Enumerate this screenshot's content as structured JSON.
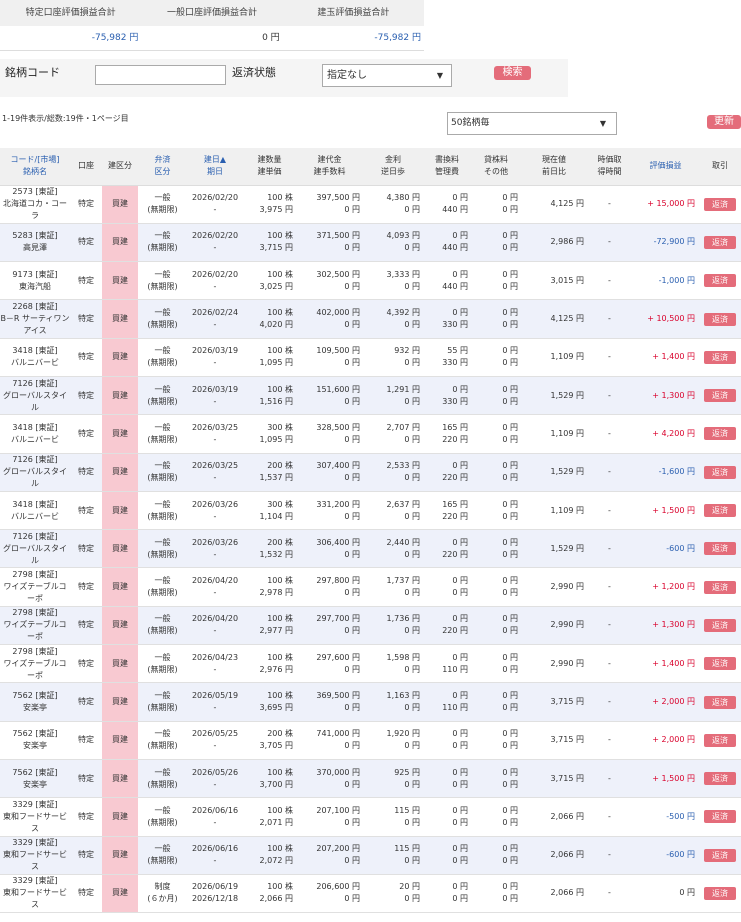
{
  "summary": {
    "headers": [
      "特定口座評価損益合計",
      "一般口座評価損益合計",
      "建玉評価損益合計"
    ],
    "values": [
      "-75,982 円",
      "0 円",
      "-75,982 円"
    ]
  },
  "search": {
    "code_label": "銘柄コード",
    "code_value": "",
    "status_label": "返済状態",
    "status_value": "指定なし",
    "search_button": "検索"
  },
  "list": {
    "count_text": "1-19件表示/総数:19件・1ページ目",
    "per_page": "50銘柄毎",
    "refresh_button": "更新"
  },
  "columns": [
    [
      "コード/[市場]",
      "銘柄名"
    ],
    [
      "口座"
    ],
    [
      "建区分"
    ],
    [
      "弁済",
      "区分"
    ],
    [
      "建日▲",
      "期日"
    ],
    [
      "建数量",
      "建単価"
    ],
    [
      "建代金",
      "建手数料"
    ],
    [
      "金利",
      "逆日歩"
    ],
    [
      "書換料",
      "管理費"
    ],
    [
      "貸株料",
      "その他"
    ],
    [
      "現在値",
      "前日比"
    ],
    [
      "時価取",
      "得時間"
    ],
    [
      "評価損益"
    ],
    [
      "取引"
    ]
  ],
  "rows": [
    {
      "code": "2573 [東証]",
      "name": "北海道コカ・コーラ",
      "account": "特定",
      "side": "買建",
      "rep1": "一般",
      "rep2": "(無期限)",
      "date": "2026/02/20",
      "due": "-",
      "qty": "100 株",
      "price": "3,975 円",
      "amount": "397,500 円",
      "fee": "0 円",
      "interest": "4,380 円",
      "gyaku": "0 円",
      "kakikae": "0 円",
      "kanri": "440 円",
      "kashikabu": "0 円",
      "other": "0 円",
      "current": "4,125 円",
      "diff": "",
      "time": "-",
      "pl": "+ 15,000 円",
      "plc": "red",
      "action": "返済"
    },
    {
      "code": "5283 [東証]",
      "name": "高見澤",
      "account": "特定",
      "side": "買建",
      "rep1": "一般",
      "rep2": "(無期限)",
      "date": "2026/02/20",
      "due": "-",
      "qty": "100 株",
      "price": "3,715 円",
      "amount": "371,500 円",
      "fee": "0 円",
      "interest": "4,093 円",
      "gyaku": "0 円",
      "kakikae": "0 円",
      "kanri": "440 円",
      "kashikabu": "0 円",
      "other": "0 円",
      "current": "2,986 円",
      "diff": "",
      "time": "-",
      "pl": "-72,900 円",
      "plc": "blue",
      "action": "返済"
    },
    {
      "code": "9173 [東証]",
      "name": "東海汽船",
      "account": "特定",
      "side": "買建",
      "rep1": "一般",
      "rep2": "(無期限)",
      "date": "2026/02/20",
      "due": "-",
      "qty": "100 株",
      "price": "3,025 円",
      "amount": "302,500 円",
      "fee": "0 円",
      "interest": "3,333 円",
      "gyaku": "0 円",
      "kakikae": "0 円",
      "kanri": "440 円",
      "kashikabu": "0 円",
      "other": "0 円",
      "current": "3,015 円",
      "diff": "",
      "time": "-",
      "pl": "-1,000 円",
      "plc": "blue",
      "action": "返済"
    },
    {
      "code": "2268 [東証]",
      "name": "B－R サーティワン アイス",
      "account": "特定",
      "side": "買建",
      "rep1": "一般",
      "rep2": "(無期限)",
      "date": "2026/02/24",
      "due": "-",
      "qty": "100 株",
      "price": "4,020 円",
      "amount": "402,000 円",
      "fee": "0 円",
      "interest": "4,392 円",
      "gyaku": "0 円",
      "kakikae": "0 円",
      "kanri": "330 円",
      "kashikabu": "0 円",
      "other": "0 円",
      "current": "4,125 円",
      "diff": "",
      "time": "-",
      "pl": "+ 10,500 円",
      "plc": "red",
      "action": "返済"
    },
    {
      "code": "3418 [東証]",
      "name": "バルニバービ",
      "account": "特定",
      "side": "買建",
      "rep1": "一般",
      "rep2": "(無期限)",
      "date": "2026/03/19",
      "due": "-",
      "qty": "100 株",
      "price": "1,095 円",
      "amount": "109,500 円",
      "fee": "0 円",
      "interest": "932 円",
      "gyaku": "0 円",
      "kakikae": "55 円",
      "kanri": "330 円",
      "kashikabu": "0 円",
      "other": "0 円",
      "current": "1,109 円",
      "diff": "",
      "time": "-",
      "pl": "+ 1,400 円",
      "plc": "red",
      "action": "返済"
    },
    {
      "code": "7126 [東証]",
      "name": "グローバルスタイル",
      "account": "特定",
      "side": "買建",
      "rep1": "一般",
      "rep2": "(無期限)",
      "date": "2026/03/19",
      "due": "-",
      "qty": "100 株",
      "price": "1,516 円",
      "amount": "151,600 円",
      "fee": "0 円",
      "interest": "1,291 円",
      "gyaku": "0 円",
      "kakikae": "0 円",
      "kanri": "330 円",
      "kashikabu": "0 円",
      "other": "0 円",
      "current": "1,529 円",
      "diff": "",
      "time": "-",
      "pl": "+ 1,300 円",
      "plc": "red",
      "action": "返済"
    },
    {
      "code": "3418 [東証]",
      "name": "バルニバービ",
      "account": "特定",
      "side": "買建",
      "rep1": "一般",
      "rep2": "(無期限)",
      "date": "2026/03/25",
      "due": "-",
      "qty": "300 株",
      "price": "1,095 円",
      "amount": "328,500 円",
      "fee": "0 円",
      "interest": "2,707 円",
      "gyaku": "0 円",
      "kakikae": "165 円",
      "kanri": "220 円",
      "kashikabu": "0 円",
      "other": "0 円",
      "current": "1,109 円",
      "diff": "",
      "time": "-",
      "pl": "+ 4,200 円",
      "plc": "red",
      "action": "返済"
    },
    {
      "code": "7126 [東証]",
      "name": "グローバルスタイル",
      "account": "特定",
      "side": "買建",
      "rep1": "一般",
      "rep2": "(無期限)",
      "date": "2026/03/25",
      "due": "-",
      "qty": "200 株",
      "price": "1,537 円",
      "amount": "307,400 円",
      "fee": "0 円",
      "interest": "2,533 円",
      "gyaku": "0 円",
      "kakikae": "0 円",
      "kanri": "220 円",
      "kashikabu": "0 円",
      "other": "0 円",
      "current": "1,529 円",
      "diff": "",
      "time": "-",
      "pl": "-1,600 円",
      "plc": "blue",
      "action": "返済"
    },
    {
      "code": "3418 [東証]",
      "name": "バルニバービ",
      "account": "特定",
      "side": "買建",
      "rep1": "一般",
      "rep2": "(無期限)",
      "date": "2026/03/26",
      "due": "-",
      "qty": "300 株",
      "price": "1,104 円",
      "amount": "331,200 円",
      "fee": "0 円",
      "interest": "2,637 円",
      "gyaku": "0 円",
      "kakikae": "165 円",
      "kanri": "220 円",
      "kashikabu": "0 円",
      "other": "0 円",
      "current": "1,109 円",
      "diff": "",
      "time": "-",
      "pl": "+ 1,500 円",
      "plc": "red",
      "action": "返済"
    },
    {
      "code": "7126 [東証]",
      "name": "グローバルスタイル",
      "account": "特定",
      "side": "買建",
      "rep1": "一般",
      "rep2": "(無期限)",
      "date": "2026/03/26",
      "due": "-",
      "qty": "200 株",
      "price": "1,532 円",
      "amount": "306,400 円",
      "fee": "0 円",
      "interest": "2,440 円",
      "gyaku": "0 円",
      "kakikae": "0 円",
      "kanri": "220 円",
      "kashikabu": "0 円",
      "other": "0 円",
      "current": "1,529 円",
      "diff": "",
      "time": "-",
      "pl": "-600 円",
      "plc": "blue",
      "action": "返済"
    },
    {
      "code": "2798 [東証]",
      "name": "ワイズテーブルコーポ",
      "account": "特定",
      "side": "買建",
      "rep1": "一般",
      "rep2": "(無期限)",
      "date": "2026/04/20",
      "due": "-",
      "qty": "100 株",
      "price": "2,978 円",
      "amount": "297,800 円",
      "fee": "0 円",
      "interest": "1,737 円",
      "gyaku": "0 円",
      "kakikae": "0 円",
      "kanri": "0 円",
      "kashikabu": "0 円",
      "other": "0 円",
      "current": "2,990 円",
      "diff": "",
      "time": "-",
      "pl": "+ 1,200 円",
      "plc": "red",
      "action": "返済"
    },
    {
      "code": "2798 [東証]",
      "name": "ワイズテーブルコーポ",
      "account": "特定",
      "side": "買建",
      "rep1": "一般",
      "rep2": "(無期限)",
      "date": "2026/04/20",
      "due": "-",
      "qty": "100 株",
      "price": "2,977 円",
      "amount": "297,700 円",
      "fee": "0 円",
      "interest": "1,736 円",
      "gyaku": "0 円",
      "kakikae": "0 円",
      "kanri": "220 円",
      "kashikabu": "0 円",
      "other": "0 円",
      "current": "2,990 円",
      "diff": "",
      "time": "-",
      "pl": "+ 1,300 円",
      "plc": "red",
      "action": "返済"
    },
    {
      "code": "2798 [東証]",
      "name": "ワイズテーブルコーポ",
      "account": "特定",
      "side": "買建",
      "rep1": "一般",
      "rep2": "(無期限)",
      "date": "2026/04/23",
      "due": "-",
      "qty": "100 株",
      "price": "2,976 円",
      "amount": "297,600 円",
      "fee": "0 円",
      "interest": "1,598 円",
      "gyaku": "0 円",
      "kakikae": "0 円",
      "kanri": "110 円",
      "kashikabu": "0 円",
      "other": "0 円",
      "current": "2,990 円",
      "diff": "",
      "time": "-",
      "pl": "+ 1,400 円",
      "plc": "red",
      "action": "返済"
    },
    {
      "code": "7562 [東証]",
      "name": "安楽亭",
      "account": "特定",
      "side": "買建",
      "rep1": "一般",
      "rep2": "(無期限)",
      "date": "2026/05/19",
      "due": "-",
      "qty": "100 株",
      "price": "3,695 円",
      "amount": "369,500 円",
      "fee": "0 円",
      "interest": "1,163 円",
      "gyaku": "0 円",
      "kakikae": "0 円",
      "kanri": "110 円",
      "kashikabu": "0 円",
      "other": "0 円",
      "current": "3,715 円",
      "diff": "",
      "time": "-",
      "pl": "+ 2,000 円",
      "plc": "red",
      "action": "返済"
    },
    {
      "code": "7562 [東証]",
      "name": "安楽亭",
      "account": "特定",
      "side": "買建",
      "rep1": "一般",
      "rep2": "(無期限)",
      "date": "2026/05/25",
      "due": "-",
      "qty": "200 株",
      "price": "3,705 円",
      "amount": "741,000 円",
      "fee": "0 円",
      "interest": "1,920 円",
      "gyaku": "0 円",
      "kakikae": "0 円",
      "kanri": "0 円",
      "kashikabu": "0 円",
      "other": "0 円",
      "current": "3,715 円",
      "diff": "",
      "time": "-",
      "pl": "+ 2,000 円",
      "plc": "red",
      "action": "返済"
    },
    {
      "code": "7562 [東証]",
      "name": "安楽亭",
      "account": "特定",
      "side": "買建",
      "rep1": "一般",
      "rep2": "(無期限)",
      "date": "2026/05/26",
      "due": "-",
      "qty": "100 株",
      "price": "3,700 円",
      "amount": "370,000 円",
      "fee": "0 円",
      "interest": "925 円",
      "gyaku": "0 円",
      "kakikae": "0 円",
      "kanri": "0 円",
      "kashikabu": "0 円",
      "other": "0 円",
      "current": "3,715 円",
      "diff": "",
      "time": "-",
      "pl": "+ 1,500 円",
      "plc": "red",
      "action": "返済"
    },
    {
      "code": "3329 [東証]",
      "name": "東和フードサービス",
      "account": "特定",
      "side": "買建",
      "rep1": "一般",
      "rep2": "(無期限)",
      "date": "2026/06/16",
      "due": "-",
      "qty": "100 株",
      "price": "2,071 円",
      "amount": "207,100 円",
      "fee": "0 円",
      "interest": "115 円",
      "gyaku": "0 円",
      "kakikae": "0 円",
      "kanri": "0 円",
      "kashikabu": "0 円",
      "other": "0 円",
      "current": "2,066 円",
      "diff": "",
      "time": "-",
      "pl": "-500 円",
      "plc": "blue",
      "action": "返済"
    },
    {
      "code": "3329 [東証]",
      "name": "東和フードサービス",
      "account": "特定",
      "side": "買建",
      "rep1": "一般",
      "rep2": "(無期限)",
      "date": "2026/06/16",
      "due": "-",
      "qty": "100 株",
      "price": "2,072 円",
      "amount": "207,200 円",
      "fee": "0 円",
      "interest": "115 円",
      "gyaku": "0 円",
      "kakikae": "0 円",
      "kanri": "0 円",
      "kashikabu": "0 円",
      "other": "0 円",
      "current": "2,066 円",
      "diff": "",
      "time": "-",
      "pl": "-600 円",
      "plc": "blue",
      "action": "返済"
    },
    {
      "code": "3329 [東証]",
      "name": "東和フードサービス",
      "account": "特定",
      "side": "買建",
      "rep1": "制度",
      "rep2": "(６か月)",
      "date": "2026/06/19",
      "due": "2026/12/18",
      "qty": "100 株",
      "price": "2,066 円",
      "amount": "206,600 円",
      "fee": "0 円",
      "interest": "20 円",
      "gyaku": "0 円",
      "kakikae": "0 円",
      "kanri": "0 円",
      "kashikabu": "0 円",
      "other": "0 円",
      "current": "2,066 円",
      "diff": "",
      "time": "-",
      "pl": "0 円",
      "plc": "plain",
      "action": "返済"
    }
  ],
  "colors": {
    "accent": "#e46c7a",
    "profit": "#d9002b",
    "loss": "#2a5fb0",
    "buy_cell": "#f8c9d1"
  }
}
